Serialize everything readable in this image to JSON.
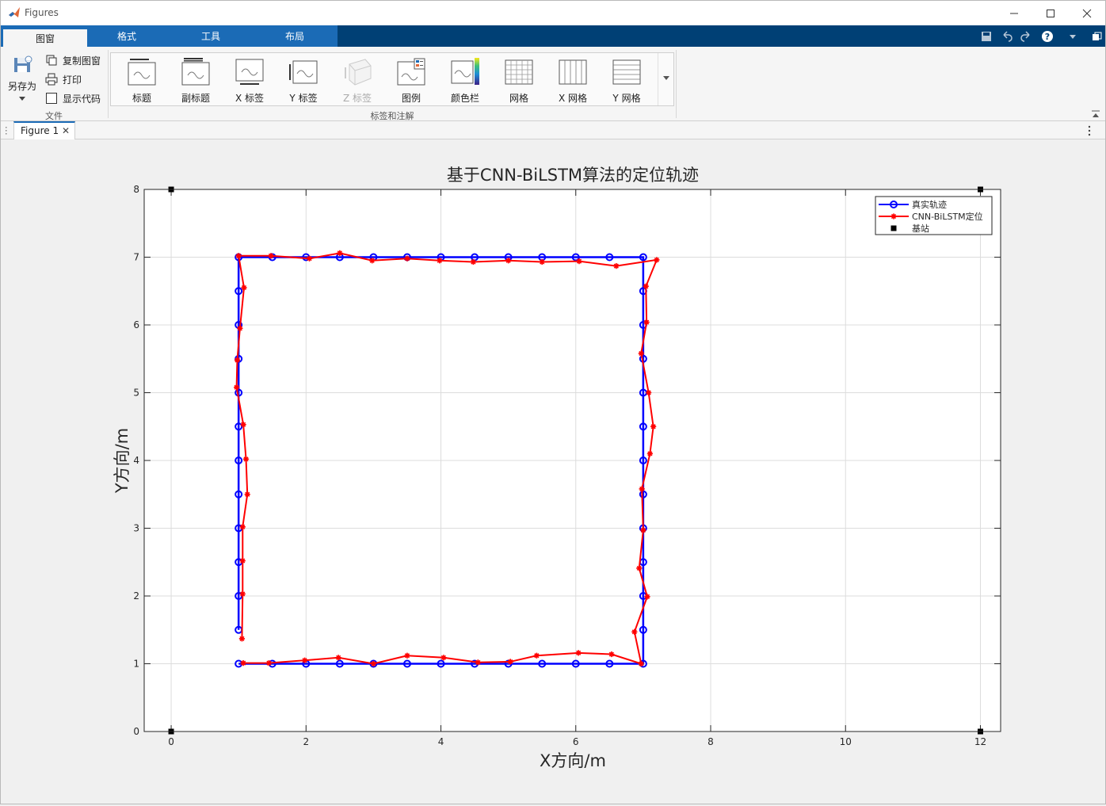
{
  "window": {
    "title": "Figures"
  },
  "tabs": [
    {
      "label": "图窗",
      "active": true
    },
    {
      "label": "格式",
      "active": false
    },
    {
      "label": "工具",
      "active": false
    },
    {
      "label": "布局",
      "active": false
    }
  ],
  "ribbon": {
    "file_group": {
      "label": "文件",
      "save_as": "另存为",
      "copy_figure": "复制图窗",
      "print": "打印",
      "show_code": "显示代码"
    },
    "labels_group": {
      "label": "标签和注解",
      "items": [
        {
          "label": "标题",
          "icon": "title-icon",
          "enabled": true
        },
        {
          "label": "副标题",
          "icon": "subtitle-icon",
          "enabled": true
        },
        {
          "label": "X 标签",
          "icon": "xlabel-icon",
          "enabled": true
        },
        {
          "label": "Y 标签",
          "icon": "ylabel-icon",
          "enabled": true
        },
        {
          "label": "Z 标签",
          "icon": "zlabel-icon",
          "enabled": false
        },
        {
          "label": "图例",
          "icon": "legend-icon",
          "enabled": true
        },
        {
          "label": "颜色栏",
          "icon": "colorbar-icon",
          "enabled": true
        },
        {
          "label": "网格",
          "icon": "grid-icon",
          "enabled": true
        },
        {
          "label": "X 网格",
          "icon": "xgrid-icon",
          "enabled": true
        },
        {
          "label": "Y 网格",
          "icon": "ygrid-icon",
          "enabled": true
        }
      ]
    }
  },
  "document_tab": {
    "label": "Figure 1"
  },
  "colors": {
    "accent": "#1b6bb6",
    "tabstrip": "#004075",
    "true_path": "#0000ff",
    "estimate": "#ff0000",
    "station": "#000000"
  },
  "chart_data": {
    "type": "line",
    "title": "基于CNN-BiLSTM算法的定位轨迹",
    "xlabel": "X方向/m",
    "ylabel": "Y方向/m",
    "xlim": [
      -0.4,
      12.3
    ],
    "ylim": [
      0,
      8
    ],
    "xticks": [
      0,
      2,
      4,
      6,
      8,
      10,
      12
    ],
    "yticks": [
      0,
      1,
      2,
      3,
      4,
      5,
      6,
      7,
      8
    ],
    "grid": true,
    "legend_position": "top-right",
    "series": [
      {
        "name": "真实轨迹",
        "color": "#0000ff",
        "marker": "circle",
        "x": [
          1,
          1,
          1,
          1,
          1,
          1,
          1,
          1,
          1,
          1,
          1,
          1,
          1.5,
          2,
          2.5,
          3,
          3.5,
          4,
          4.5,
          5,
          5.5,
          6,
          6.5,
          7,
          7,
          7,
          7,
          7,
          7,
          7,
          7,
          7,
          7,
          7,
          7,
          7,
          6.5,
          6,
          5.5,
          5,
          4.5,
          4,
          3.5,
          3,
          2.5,
          2,
          1.5,
          1
        ],
        "y": [
          1.5,
          2,
          2.5,
          3,
          3.5,
          4,
          4.5,
          5,
          5.5,
          6,
          6.5,
          7,
          7,
          7,
          7,
          7,
          7,
          7,
          7,
          7,
          7,
          7,
          7,
          7,
          6.5,
          6,
          5.5,
          5,
          4.5,
          4,
          3.5,
          3,
          2.5,
          2,
          1.5,
          1,
          1,
          1,
          1,
          1,
          1,
          1,
          1,
          1,
          1,
          1,
          1,
          1
        ]
      },
      {
        "name": "CNN-BiLSTM定位",
        "color": "#ff0000",
        "marker": "asterisk",
        "x": [
          1.05,
          1.06,
          1.06,
          1.06,
          1.13,
          1.11,
          1.07,
          0.97,
          0.98,
          1.02,
          1.08,
          1.0,
          1.48,
          2.05,
          2.5,
          2.98,
          3.5,
          3.98,
          4.48,
          5.0,
          5.5,
          6.05,
          6.6,
          7.2,
          7.04,
          7.05,
          6.97,
          7.08,
          7.15,
          7.1,
          6.98,
          7.0,
          6.94,
          7.06,
          6.87,
          6.97,
          6.53,
          6.04,
          5.42,
          5.03,
          4.55,
          4.04,
          3.5,
          3.0,
          2.48,
          1.98,
          1.45,
          1.07
        ],
        "y": [
          1.37,
          2.03,
          2.52,
          3.02,
          3.5,
          4.02,
          4.53,
          5.08,
          5.48,
          5.95,
          6.55,
          7.02,
          7.02,
          6.98,
          7.06,
          6.95,
          6.98,
          6.95,
          6.93,
          6.95,
          6.93,
          6.94,
          6.87,
          6.96,
          6.57,
          6.04,
          5.58,
          5.0,
          4.5,
          4.1,
          3.58,
          2.97,
          2.41,
          1.99,
          1.47,
          1.0,
          1.14,
          1.16,
          1.12,
          1.03,
          1.02,
          1.09,
          1.12,
          1.0,
          1.09,
          1.05,
          1.01,
          1.01
        ]
      },
      {
        "name": "基站",
        "color": "#000000",
        "marker": "square",
        "x": [
          0,
          12,
          0,
          12
        ],
        "y": [
          8,
          8,
          0,
          0
        ]
      }
    ]
  }
}
